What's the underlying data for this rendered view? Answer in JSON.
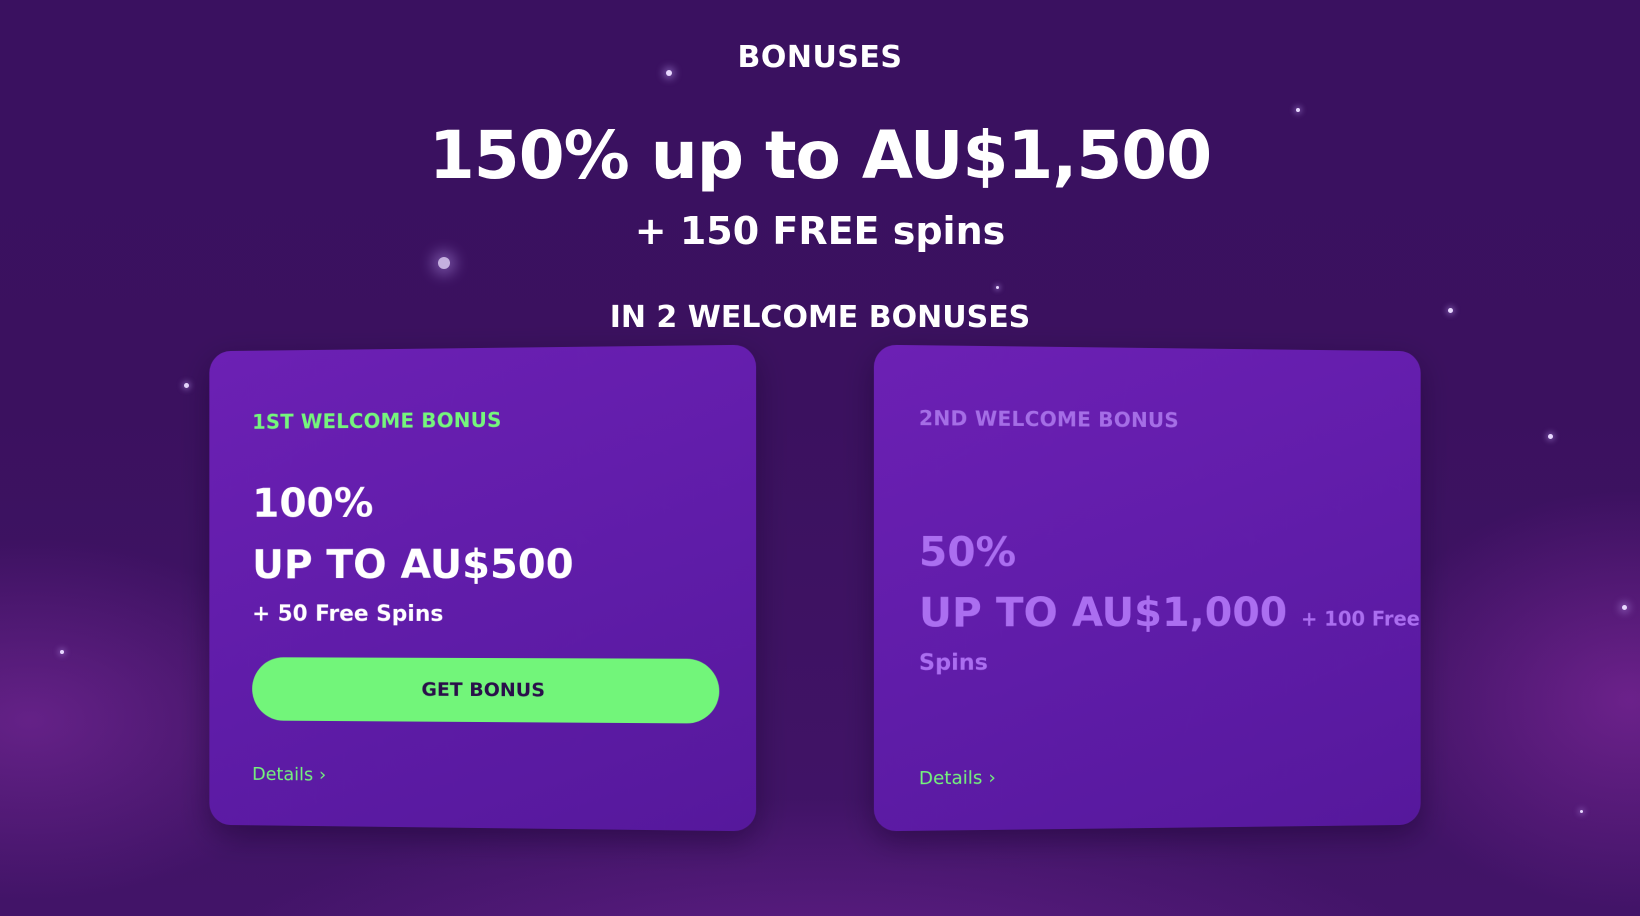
{
  "page": {
    "eyebrow": "BONUSES",
    "headline": "150% up to AU$1,500",
    "subline": "+ 150 FREE spins",
    "note": "IN 2 WELCOME BONUSES"
  },
  "cards": [
    {
      "label": "1ST WELCOME BONUS",
      "percent": "100%",
      "upto": "UP TO AU$500",
      "spins": "+ 50 Free Spins",
      "cta": "GET BONUS",
      "details": "Details",
      "details_icon": "chevron-right-icon"
    },
    {
      "label": "2ND WELCOME BONUS",
      "percent": "50%",
      "upto": "UP TO AU$1,000",
      "spins_inline": "+ 100 Free",
      "spins_cont": "Spins",
      "details": "Details",
      "details_icon": "chevron-right-icon"
    }
  ],
  "colors": {
    "background": "#3b115f",
    "card": "#601ca9",
    "accent_green": "#72f57a",
    "muted_purple": "#ab6ef0",
    "text": "#ffffff"
  }
}
